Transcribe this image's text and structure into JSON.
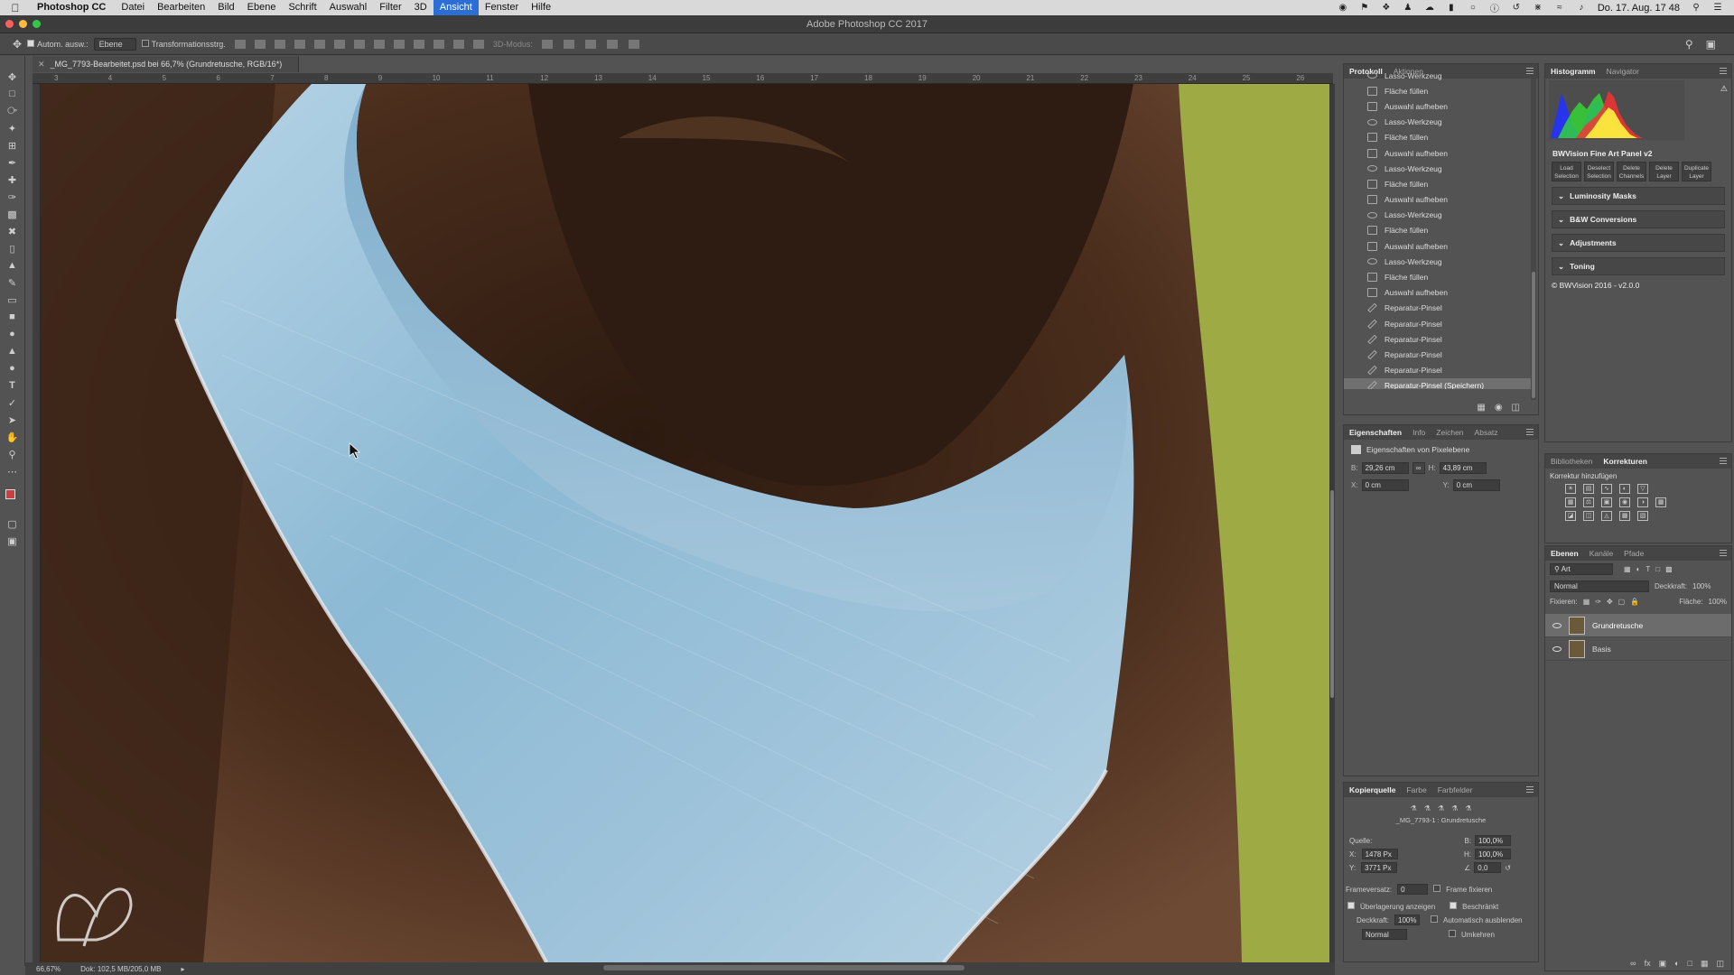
{
  "menubar": {
    "app": "Photoshop CC",
    "items": [
      "Datei",
      "Bearbeiten",
      "Bild",
      "Ebene",
      "Schrift",
      "Auswahl",
      "Filter",
      "3D",
      "Ansicht",
      "Fenster",
      "Hilfe"
    ],
    "active_item": "Ansicht",
    "clock": "Do. 17. Aug. 17 48"
  },
  "window": {
    "title": "Adobe Photoshop CC 2017"
  },
  "options": {
    "auto_select_label": "Autom. ausw.:",
    "auto_select_target": "Ebene",
    "transform_label": "Transformationsstrg.",
    "mode_3d_label": "3D-Modus:"
  },
  "document": {
    "tab_title": "_MG_7793-Bearbeitet.psd bei 66,7% (Grundretusche, RGB/16*)",
    "ruler_ticks": [
      "3",
      "4",
      "5",
      "6",
      "7",
      "8",
      "9",
      "10",
      "11",
      "12",
      "13",
      "14",
      "15",
      "16",
      "17",
      "18",
      "19",
      "20",
      "21",
      "22",
      "23",
      "24",
      "25",
      "26"
    ],
    "zoom": "66,67%",
    "doc_size": "Dok: 102,5 MB/205,0 MB"
  },
  "history": {
    "tabs": [
      "Protokoll",
      "Aktionen"
    ],
    "items": [
      {
        "label": "Lasso-Werkzeug",
        "icon": "lasso"
      },
      {
        "label": "Fläche füllen",
        "icon": "doc"
      },
      {
        "label": "Auswahl aufheben",
        "icon": "doc"
      },
      {
        "label": "Lasso-Werkzeug",
        "icon": "lasso"
      },
      {
        "label": "Fläche füllen",
        "icon": "doc"
      },
      {
        "label": "Auswahl aufheben",
        "icon": "doc"
      },
      {
        "label": "Lasso-Werkzeug",
        "icon": "lasso"
      },
      {
        "label": "Fläche füllen",
        "icon": "doc"
      },
      {
        "label": "Auswahl aufheben",
        "icon": "doc"
      },
      {
        "label": "Lasso-Werkzeug",
        "icon": "lasso"
      },
      {
        "label": "Fläche füllen",
        "icon": "doc"
      },
      {
        "label": "Auswahl aufheben",
        "icon": "doc"
      },
      {
        "label": "Lasso-Werkzeug",
        "icon": "lasso"
      },
      {
        "label": "Fläche füllen",
        "icon": "doc"
      },
      {
        "label": "Auswahl aufheben",
        "icon": "doc"
      },
      {
        "label": "Reparatur-Pinsel",
        "icon": "brush"
      },
      {
        "label": "Reparatur-Pinsel",
        "icon": "brush"
      },
      {
        "label": "Reparatur-Pinsel",
        "icon": "brush"
      },
      {
        "label": "Reparatur-Pinsel",
        "icon": "brush"
      },
      {
        "label": "Reparatur-Pinsel",
        "icon": "brush"
      },
      {
        "label": "Reparatur-Pinsel (Speichern)",
        "icon": "brush"
      }
    ],
    "selected_index": 20
  },
  "properties": {
    "tabs": [
      "Eigenschaften",
      "Info",
      "Zeichen",
      "Absatz"
    ],
    "header": "Eigenschaften von Pixelebene",
    "w_label": "B:",
    "w_value": "29,26 cm",
    "h_label": "H:",
    "h_value": "43,89 cm",
    "x_label": "X:",
    "x_value": "0 cm",
    "y_label": "Y:",
    "y_value": "0 cm"
  },
  "clone_source": {
    "tabs": [
      "Kopierquelle",
      "Farbe",
      "Farbfelder"
    ],
    "source_name": "_MG_7793-1 : Grundretusche",
    "quelle_label": "Quelle:",
    "x_label": "X:",
    "x_value": "1478 Px",
    "y_label": "Y:",
    "y_value": "3771 Px",
    "scale_w_label": "B:",
    "scale_w": "100,0%",
    "scale_h_label": "H:",
    "scale_h": "100,0%",
    "angle": "0,0",
    "frame_offset_label": "Frameversatz:",
    "frame_offset": "0",
    "frame_lock_label": "Frame fixieren",
    "show_overlay_label": "Überlagerung anzeigen",
    "clipped_label": "Beschränkt",
    "opacity_label": "Deckkraft:",
    "opacity": "100%",
    "auto_hide_label": "Automatisch ausblenden",
    "invert_label": "Umkehren",
    "blend_mode": "Normal"
  },
  "histogram": {
    "tabs": [
      "Histogramm",
      "Navigator"
    ],
    "bv_title": "BWVision Fine Art Panel v2",
    "bv_buttons": [
      {
        "l1": "Load",
        "l2": "Selection"
      },
      {
        "l1": "Deselect",
        "l2": "Selection"
      },
      {
        "l1": "Delete",
        "l2": "Channels"
      },
      {
        "l1": "Delete",
        "l2": "Layer"
      },
      {
        "l1": "Duplicate",
        "l2": "Layer"
      }
    ],
    "sections": [
      "Luminosity Masks",
      "B&W Conversions",
      "Adjustments",
      "Toning"
    ],
    "credit": "© BWVision 2016 - v2.0.0"
  },
  "korrekturen": {
    "tabs": [
      "Bibliotheken",
      "Korrekturen"
    ],
    "label": "Korrektur hinzufügen"
  },
  "layers": {
    "tabs": [
      "Ebenen",
      "Kanäle",
      "Pfade"
    ],
    "filter": "Art",
    "blend_mode": "Normal",
    "opacity_label": "Deckkraft:",
    "opacity": "100%",
    "lock_label": "Fixieren:",
    "fill_label": "Fläche:",
    "fill": "100%",
    "items": [
      {
        "name": "Grundretusche",
        "selected": true
      },
      {
        "name": "Basis",
        "selected": false
      }
    ]
  }
}
